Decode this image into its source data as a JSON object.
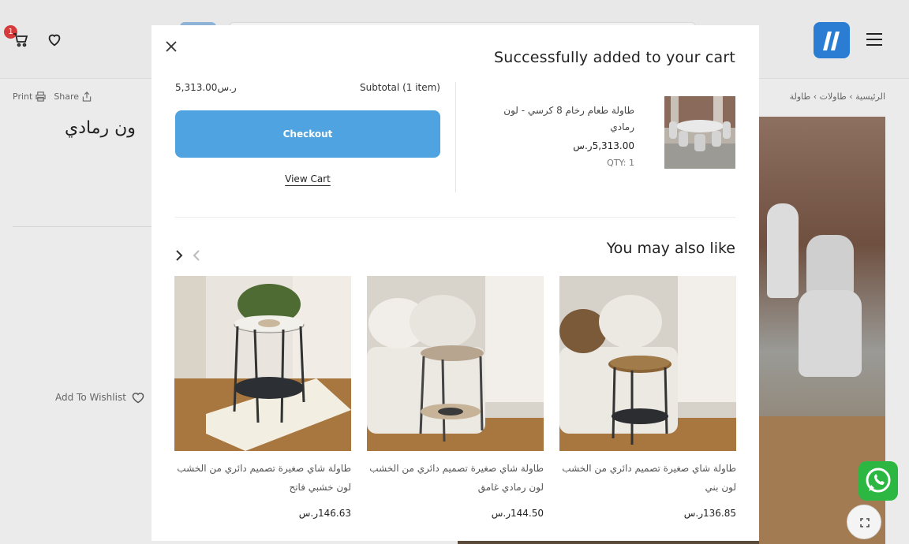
{
  "header": {
    "cart_badge": "1",
    "cart_icon": "cart-icon",
    "wishlist_icon": "heart-icon",
    "menu_icon": "hamburger-icon"
  },
  "page": {
    "print_label": "Print",
    "share_label": "Share",
    "product_title": "ون رمادي",
    "add_to_wishlist": "Add To Wishlist",
    "breadcrumb": "الرئيسية  ›  طاولات  ›  طاولة"
  },
  "modal": {
    "title": "Successfully added to your cart",
    "subtotal_label": "Subtotal (1 item)",
    "subtotal_value": "5,313.00ر.س",
    "checkout_label": "Checkout",
    "view_cart_label": "View Cart",
    "item": {
      "name": "طاولة طعام رخام 8 كرسي - لون رمادي",
      "price": "5,313.00ر.س",
      "qty": "QTY: 1"
    },
    "you_may_also_like": "You may also like",
    "products": [
      {
        "name": "طاولة شاي صغيرة تصميم دائري من الخشب لون بني",
        "price": "136.85ر.س"
      },
      {
        "name": "طاولة شاي صغيرة تصميم دائري من الخشب لون رمادي غامق",
        "price": "144.50ر.س"
      },
      {
        "name": "طاولة شاي صغيرة تصميم دائري من الخشب لون خشبي فاتح",
        "price": "146.63ر.س"
      }
    ]
  },
  "colors": {
    "checkout": "#4ea3e0",
    "badge": "#d63b3b",
    "whatsapp": "#2bb741",
    "logo": "#2b7dd3"
  }
}
